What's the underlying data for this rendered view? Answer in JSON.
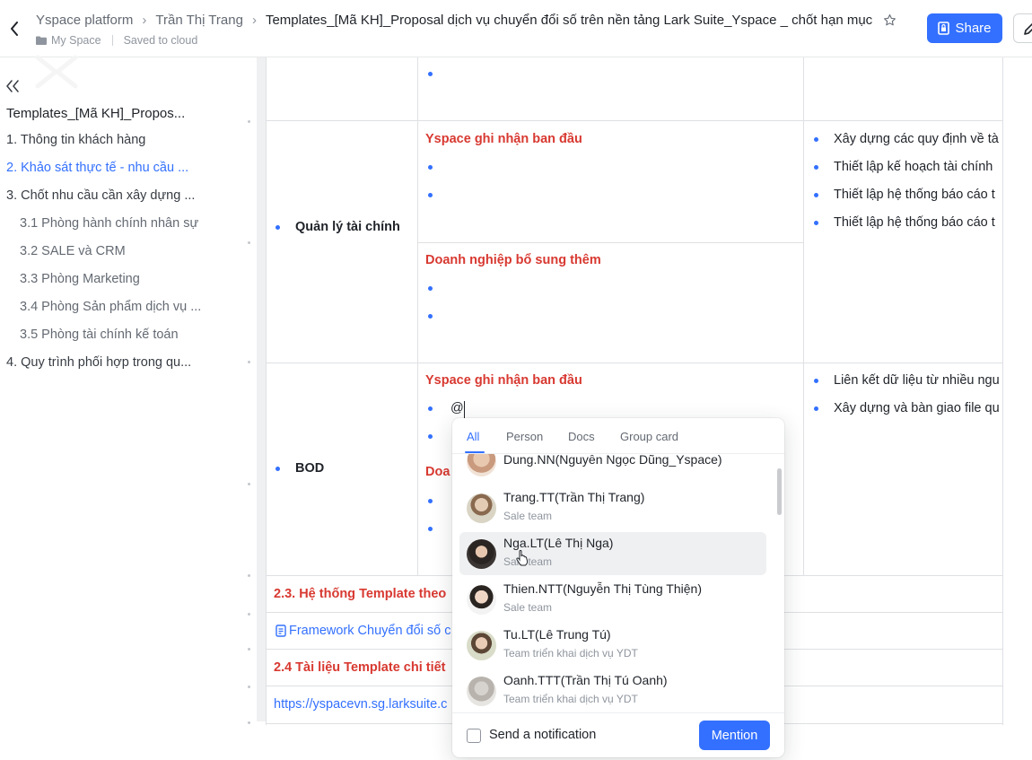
{
  "header": {
    "breadcrumbs": [
      "Yspace platform",
      "Trần Thị Trang"
    ],
    "title": "Templates_[Mã KH]_Proposal dịch vụ chuyển đổi số trên nền tảng Lark Suite_Yspace _ chốt hạn mục",
    "location": "My Space",
    "save_status": "Saved to cloud",
    "share_label": "Share"
  },
  "toc": {
    "doc_title": "Templates_[Mã KH]_Propos...",
    "items": [
      "1. Thông tin khách hàng",
      "2. Khảo sát thực tế - nhu cầu ...",
      "3. Chốt nhu cầu cần xây dựng ...",
      "3.1 Phòng hành chính nhân sự",
      "3.2 SALE và CRM",
      "3.3 Phòng Marketing",
      "3.4 Phòng Sản phẩm dịch vụ ...",
      "3.5 Phòng tài chính kế toán",
      "4. Quy trình phối hợp trong qu..."
    ]
  },
  "table": {
    "row_finance": {
      "label": "Quản lý tài chính",
      "heading_initial": "Yspace ghi nhận ban đầu",
      "heading_added": "Doanh nghiệp bổ sung thêm",
      "right_items": [
        "Xây dựng các quy định về tà",
        "Thiết lập kế hoạch tài chính",
        "Thiết lập hệ thống báo cáo t",
        "Thiết lập hệ thống báo cáo t"
      ]
    },
    "row_bod": {
      "label": "BOD",
      "heading_initial": "Yspace ghi nhận ban đầu",
      "typed_text": "@",
      "heading_added_partial": "Doa",
      "right_items": [
        "Liên kết dữ liệu từ nhiều ngu",
        "Xây dựng và bàn giao file qu"
      ]
    },
    "section_23": "2.3. Hệ thống Template theo",
    "framework_link": "Framework Chuyển đổi số c",
    "section_24": "2.4 Tài liệu Template chi tiết",
    "url_link": "https://yspacevn.sg.larksuite.c"
  },
  "mention_popup": {
    "tabs": [
      "All",
      "Person",
      "Docs",
      "Group card"
    ],
    "active_tab": "All",
    "people": [
      {
        "name": "Dung.NN(Nguyễn Ngọc Dũng_Yspace)",
        "team": ""
      },
      {
        "name": "Trang.TT(Trần Thị Trang)",
        "team": "Sale team"
      },
      {
        "name": "Nga.LT(Lê Thị Nga)",
        "team": "Sale team"
      },
      {
        "name": "Thien.NTT(Nguyễn Thị Tùng Thiện)",
        "team": "Sale team"
      },
      {
        "name": "Tu.LT(Lê Trung Tú)",
        "team": "Team triển khai dịch vụ YDT"
      },
      {
        "name": "Oanh.TTT(Trần Thị Tú Oanh)",
        "team": "Team triển khai dịch vụ YDT"
      }
    ],
    "notify_label": "Send a notification",
    "mention_button": "Mention"
  },
  "colors": {
    "accent": "#3370ff",
    "heading_red": "#d83931",
    "hover_row": "#eff0f1"
  }
}
